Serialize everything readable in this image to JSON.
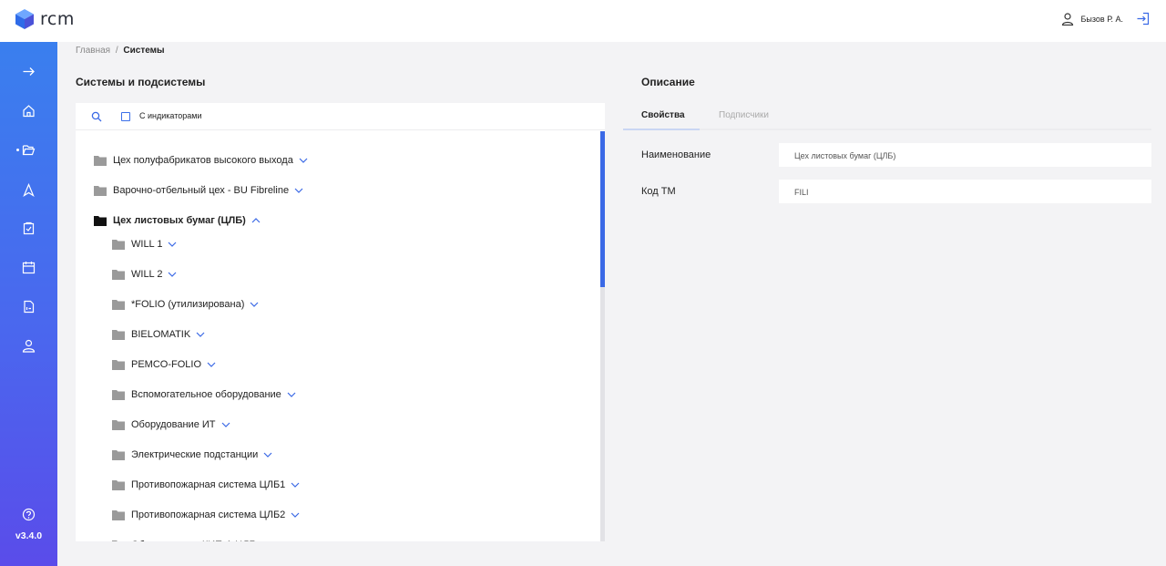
{
  "app": {
    "logo_text": "rcm",
    "version": "v3.4.0"
  },
  "header": {
    "user_name": "Бызов Р. А."
  },
  "sidebar": {
    "items": [
      {
        "name": "expand",
        "icon": "arrow-right-icon"
      },
      {
        "name": "home",
        "icon": "home-icon"
      },
      {
        "name": "systems",
        "icon": "folder-open-icon",
        "active": true
      },
      {
        "name": "navigation",
        "icon": "navigation-icon"
      },
      {
        "name": "tasks",
        "icon": "clipboard-icon"
      },
      {
        "name": "calendar",
        "icon": "calendar-icon"
      },
      {
        "name": "reports",
        "icon": "report-icon"
      },
      {
        "name": "users",
        "icon": "user-icon"
      }
    ],
    "help_icon": "help-icon"
  },
  "breadcrumb": {
    "home": "Главная",
    "separator": "/",
    "current": "Системы"
  },
  "left": {
    "title": "Системы и подсистемы",
    "filter_label": "С индикаторами",
    "tree": [
      {
        "label": "Цех полуфабрикатов высокого выхода",
        "level": 0,
        "expanded": false
      },
      {
        "label": "Варочно-отбельный цех - BU Fibreline",
        "level": 0,
        "expanded": false
      },
      {
        "label": "Цех листовых бумаг (ЦЛБ)",
        "level": 0,
        "expanded": true,
        "selected": true
      },
      {
        "label": "WILL 1",
        "level": 1,
        "expanded": false
      },
      {
        "label": "WILL 2",
        "level": 1,
        "expanded": false
      },
      {
        "label": "*FOLIO (утилизирована)",
        "level": 1,
        "expanded": false
      },
      {
        "label": "BIELOMATIK",
        "level": 1,
        "expanded": false
      },
      {
        "label": "PEMCO-FOLIO",
        "level": 1,
        "expanded": false
      },
      {
        "label": "Вспомогательное оборудование",
        "level": 1,
        "expanded": false
      },
      {
        "label": "Оборудование ИТ",
        "level": 1,
        "expanded": false
      },
      {
        "label": "Электрические подстанции",
        "level": 1,
        "expanded": false
      },
      {
        "label": "Противопожарная система ЦЛБ1",
        "level": 1,
        "expanded": false
      },
      {
        "label": "Противопожарная система ЦЛБ2",
        "level": 1,
        "expanded": false
      },
      {
        "label": "Оборудование КИП-А ЦЛБ",
        "level": 1,
        "expanded": false
      }
    ]
  },
  "right": {
    "title": "Описание",
    "tabs": [
      {
        "label": "Свойства",
        "active": true
      },
      {
        "label": "Подписчики",
        "active": false
      }
    ],
    "properties": [
      {
        "label": "Наименование",
        "value": "Цех листовых бумаг (ЦЛБ)"
      },
      {
        "label": "Код ТМ",
        "value": "FILI"
      }
    ]
  },
  "colors": {
    "accent": "#3a69e6",
    "sidebar_top": "#3a7fee",
    "sidebar_bottom": "#5a4cea"
  }
}
